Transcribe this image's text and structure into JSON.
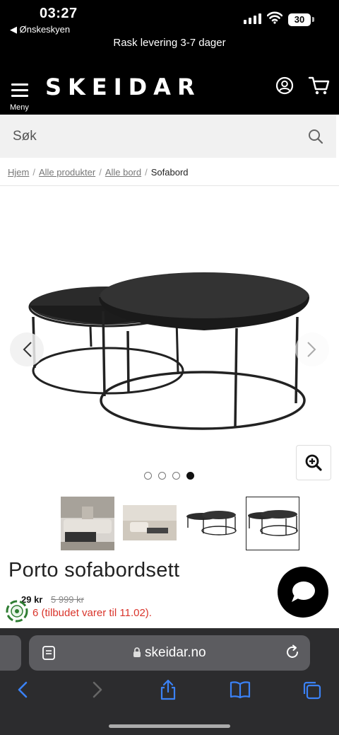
{
  "status_bar": {
    "time": "03:27",
    "back_app": "◀ Ønskeskyen",
    "battery": "30"
  },
  "promo": {
    "text": "Rask levering 3-7 dager"
  },
  "header": {
    "logo": "SKEIDAR",
    "menu_label": "Meny"
  },
  "search": {
    "placeholder": "Søk"
  },
  "breadcrumb": {
    "items": [
      "Hjem",
      "Alle produkter",
      "Alle bord"
    ],
    "current": "Sofabord",
    "separator": "/"
  },
  "gallery": {
    "image_count": 4,
    "active_index": 3
  },
  "product": {
    "title": "Porto sofabordsett",
    "price": "29 kr",
    "old_price": "5 999 kr",
    "offer_text": "6 (tilbudet varer til 11.02)."
  },
  "browser": {
    "url": "skeidar.no"
  },
  "colors": {
    "header_bg": "#000000",
    "offer_red": "#d9342b",
    "safari_bar": "#2c2c2e",
    "ios_blue": "#3b82f6"
  }
}
